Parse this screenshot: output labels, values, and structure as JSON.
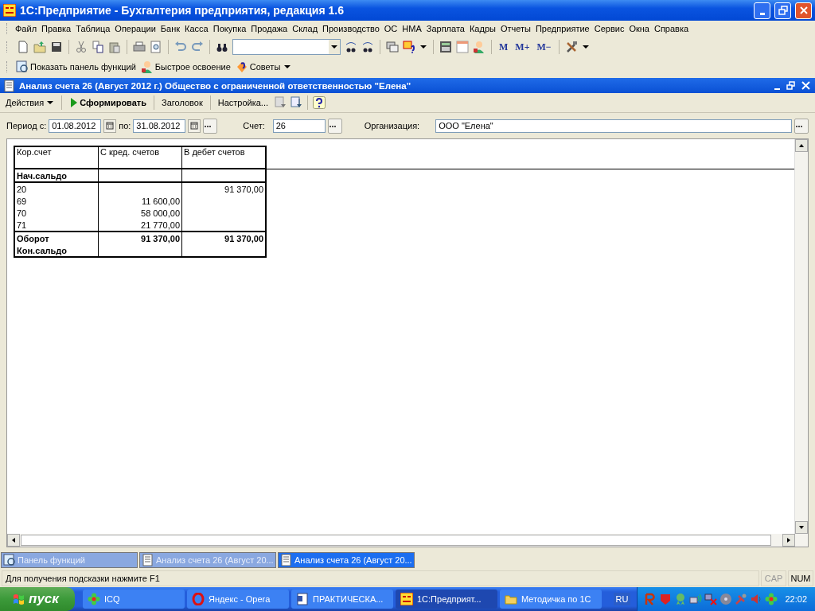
{
  "window": {
    "title": "1С:Предприятие - Бухгалтерия предприятия, редакция 1.6"
  },
  "menu": [
    {
      "label": "Файл"
    },
    {
      "label": "Правка"
    },
    {
      "label": "Таблица"
    },
    {
      "label": "Операции"
    },
    {
      "label": "Банк"
    },
    {
      "label": "Касса"
    },
    {
      "label": "Покупка"
    },
    {
      "label": "Продажа"
    },
    {
      "label": "Склад"
    },
    {
      "label": "Производство"
    },
    {
      "label": "ОС"
    },
    {
      "label": "НМА"
    },
    {
      "label": "Зарплата"
    },
    {
      "label": "Кадры"
    },
    {
      "label": "Отчеты"
    },
    {
      "label": "Предприятие"
    },
    {
      "label": "Сервис"
    },
    {
      "label": "Окна"
    },
    {
      "label": "Справка"
    }
  ],
  "memory_buttons": [
    "M",
    "M+",
    "M−"
  ],
  "quick_bar": [
    {
      "label": "Показать панель функций",
      "kind": "panel"
    },
    {
      "label": "Быстрое освоение",
      "kind": "person"
    },
    {
      "label": "Советы",
      "kind": "tips"
    }
  ],
  "report_window": {
    "title": "Анализ счета 26 (Август 2012 г.) Общество с ограниченной ответственностью \"Елена\"",
    "actions": [
      {
        "label": "Действия",
        "kind": "menu"
      },
      {
        "label": "Сформировать",
        "kind": "primary"
      },
      {
        "label": "Заголовок",
        "kind": "plain"
      },
      {
        "label": "Настройка...",
        "kind": "plain"
      }
    ]
  },
  "filters": {
    "period_from_label": "Период с:",
    "period_from": "01.08.2012",
    "period_to_label": "по:",
    "period_to": "31.08.2012",
    "account_label": "Счет:",
    "account": "26",
    "organization_label": "Организация:",
    "organization": "ООО \"Елена\""
  },
  "report": {
    "columns": [
      "Кор.счет",
      "С кред. счетов",
      "В дебет счетов"
    ],
    "rows": [
      {
        "kind": "section",
        "account": "Нач.сальдо"
      },
      {
        "kind": "data",
        "account": "20",
        "debit": "91 370,00"
      },
      {
        "kind": "data",
        "account": "69",
        "credit": "11 600,00"
      },
      {
        "kind": "data",
        "account": "70",
        "credit": "58 000,00"
      },
      {
        "kind": "data",
        "account": "71",
        "credit": "21 770,00"
      },
      {
        "kind": "total",
        "account": "Оборот",
        "credit": "91 370,00",
        "debit": "91 370,00"
      },
      {
        "kind": "closing",
        "account": "Кон.сальдо"
      }
    ]
  },
  "window_tabs": [
    {
      "label": "Панель функций",
      "selected": false,
      "kind": "panel"
    },
    {
      "label": "Анализ счета 26 (Август 20...",
      "selected": false,
      "kind": "report"
    },
    {
      "label": "Анализ счета 26 (Август 20...",
      "selected": true,
      "kind": "report"
    }
  ],
  "status_bar": {
    "hint": "Для получения подсказки нажмите F1",
    "indicators": [
      {
        "label": "CAP",
        "on": false
      },
      {
        "label": "NUM",
        "on": true
      }
    ]
  },
  "taskbar": {
    "start": "пуск",
    "buttons": [
      {
        "label": "ICQ",
        "kind": "flower",
        "selected": false
      },
      {
        "label": "Яндекс - Opera",
        "kind": "ring",
        "selected": false
      },
      {
        "label": "ПРАКТИЧЕСКА...",
        "kind": "document",
        "selected": false
      },
      {
        "label": "1С:Предприят...",
        "kind": "logo",
        "selected": true
      },
      {
        "label": "Методичка по 1С",
        "kind": "folder",
        "selected": false
      }
    ],
    "language": "RU",
    "clock": "22:02"
  }
}
